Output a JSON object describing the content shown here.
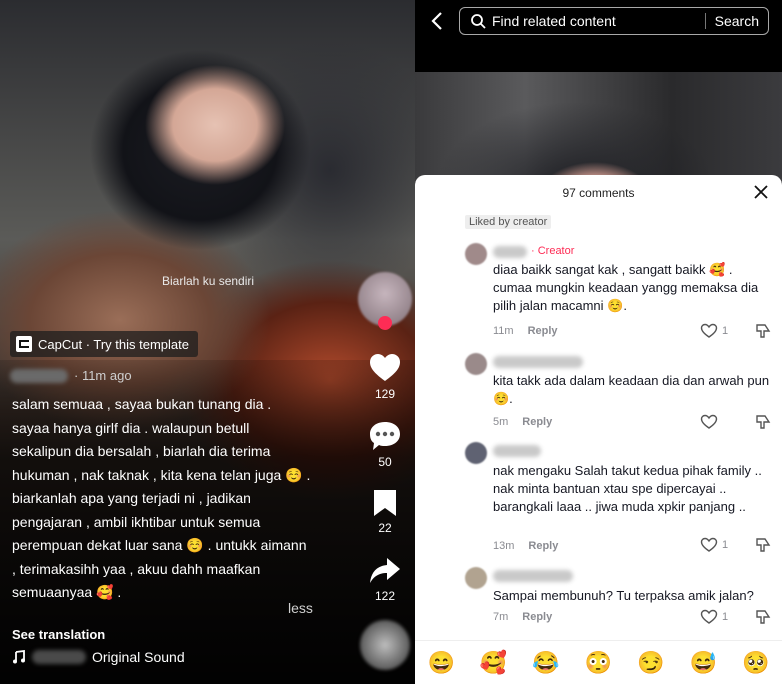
{
  "left": {
    "overlay_text": "Biarlah ku sendiri",
    "capcut_label": "CapCut · Try this template",
    "time_ago": "· 11m ago",
    "caption": "salam semuaa , sayaa bukan tunang dia . sayaa hanya girlf dia . walaupun betull sekalipun dia bersalah , biarlah dia terima hukuman , nak taknak , kita kena telan juga ☺️ . biarkanlah apa yang terjadi ni , jadikan pengajaran , ambil ikhtibar untuk semua perempuan dekat luar sana ☺️ . untukk aimann , terimakasihh yaa , akuu dahh maafkan semuaanyaa 🥰 .",
    "less": "less",
    "see_translation": "See translation",
    "sound": "Original Sound",
    "likes": "129",
    "comments": "50",
    "saves": "22",
    "shares": "122"
  },
  "right": {
    "search_placeholder": "Find related content",
    "search_button": "Search",
    "comments_count": "97 comments",
    "liked_by_creator": "Liked by creator",
    "comments": [
      {
        "creator": "· Creator",
        "text": "diaa baikk sangat kak , sangatt baikk 🥰 . cumaa mungkin keadaan yangg memaksa dia pilih jalan macamni ☺️.",
        "time": "11m",
        "reply": "Reply",
        "likes": "1"
      },
      {
        "text": "kita takk ada dalam keadaan dia dan arwah pun ☺️.",
        "time": "5m",
        "reply": "Reply",
        "likes": ""
      },
      {
        "text": "nak mengaku Salah takut kedua pihak family .. nak minta bantuan xtau spe dipercayai .. barangkali laaa .. jiwa muda xpkir panjang ..",
        "time": "13m",
        "reply": "Reply",
        "likes": "1"
      },
      {
        "text": "Sampai membunuh? Tu terpaksa amik jalan?",
        "time": "7m",
        "reply": "Reply",
        "likes": "1"
      }
    ],
    "emojis": [
      "😄",
      "🥰",
      "😂",
      "😳",
      "😏",
      "😅",
      "🥺"
    ]
  }
}
